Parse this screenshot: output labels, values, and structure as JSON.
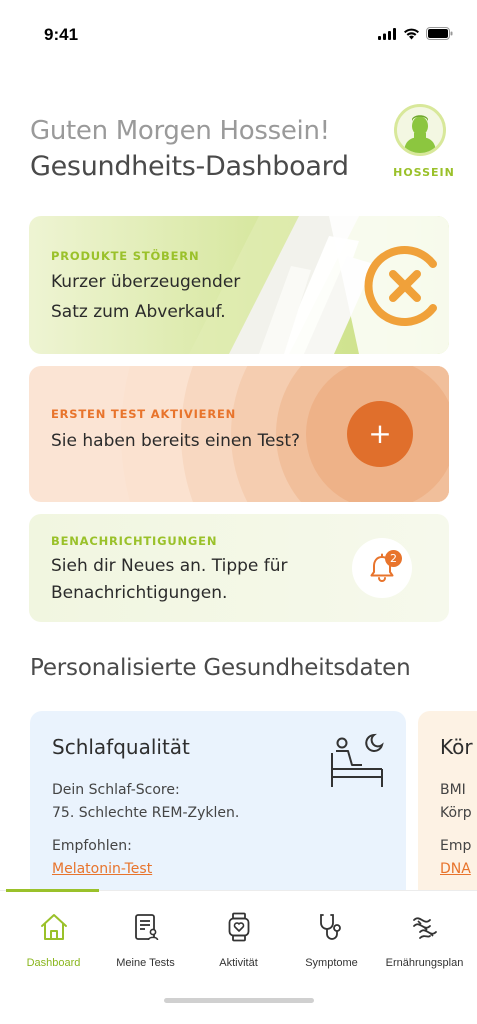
{
  "status_bar": {
    "time": "9:41"
  },
  "header": {
    "greeting": "Guten Morgen Hossein!",
    "title": "Gesundheits-Dashboard",
    "avatar_name": "HOSSEIN"
  },
  "cards": {
    "products": {
      "label": "PRODUKTE STÖBERN",
      "line1": "Kurzer überzeugender",
      "line2": "Satz zum Abverkauf."
    },
    "activate": {
      "label": "ERSTEN TEST AKTIVIEREN",
      "text": "Sie haben bereits einen Test?",
      "button": "+"
    },
    "notifications": {
      "label": "BENACHRICHTIGUNGEN",
      "line1": "Sieh dir Neues an. Tippe für",
      "line2": "Benachrichtigungen.",
      "badge": "2"
    }
  },
  "section": {
    "title": "Personalisierte Gesundheitsdaten"
  },
  "data_cards": [
    {
      "title": "Schlafqualität",
      "line1": "Dein Schlaf-Score:",
      "line2": "75. Schlechte REM-Zyklen.",
      "recommend_label": "Empfohlen:",
      "link": "Melatonin-Test"
    },
    {
      "title": "Kör",
      "line1": "BMI",
      "line2": "Körp",
      "recommend_label": "Emp",
      "link": "DNA"
    }
  ],
  "tabs": [
    {
      "label": "Dashboard",
      "icon": "home-icon",
      "active": true
    },
    {
      "label": "Meine Tests",
      "icon": "tests-document-icon",
      "active": false
    },
    {
      "label": "Aktivität",
      "icon": "smartwatch-icon",
      "active": false
    },
    {
      "label": "Symptome",
      "icon": "stethoscope-icon",
      "active": false
    },
    {
      "label": "Ernährungsplan",
      "icon": "dna-icon",
      "active": false
    }
  ],
  "colors": {
    "accent_green": "#9ac12a",
    "accent_orange": "#e8742c"
  }
}
